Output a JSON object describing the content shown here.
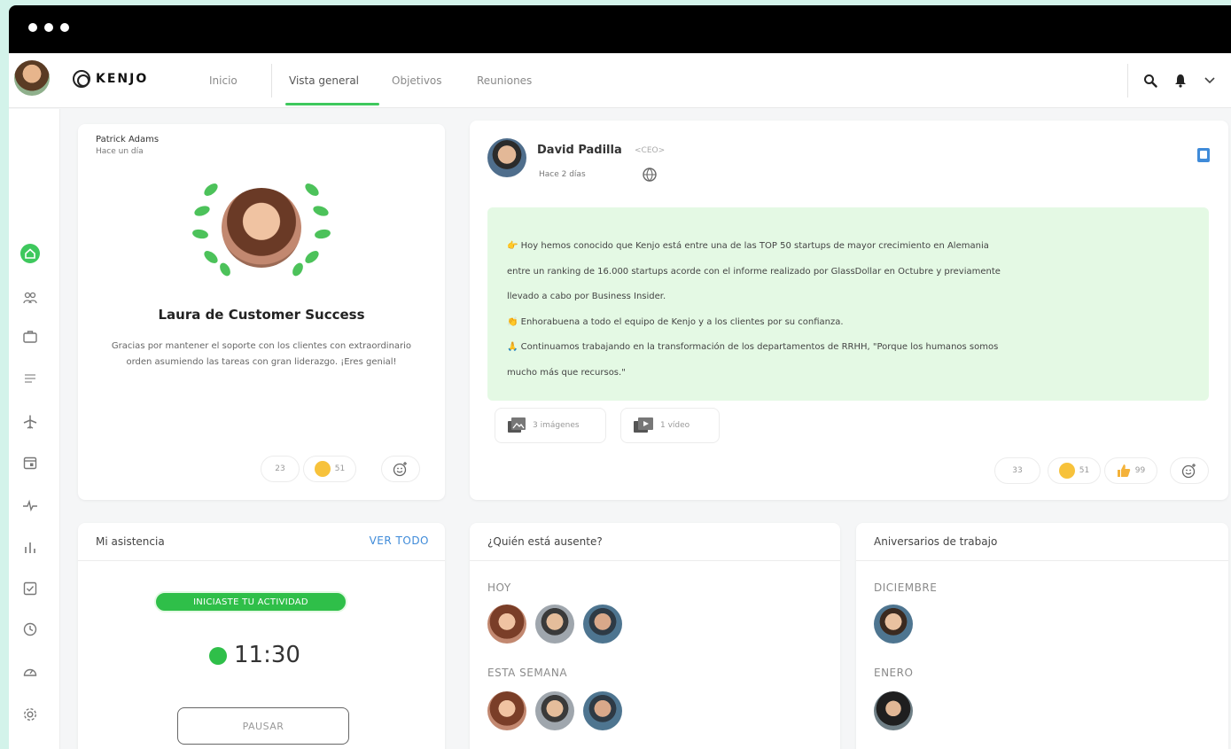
{
  "header": {
    "brand": "KENJO",
    "nav": [
      "Inicio",
      "Vista general",
      "Objetivos",
      "Reuniones"
    ],
    "active_tab": "Vista general"
  },
  "icons": {
    "top": [
      "search-icon",
      "bell-icon",
      "chevron-down-icon"
    ],
    "sidebar": [
      "home-icon",
      "people-icon",
      "briefcase-icon",
      "document-icon",
      "plane-icon",
      "calendar-icon",
      "pulse-icon",
      "chart-icon",
      "checkbox-icon",
      "clock-icon",
      "gauge-icon",
      "gear-icon"
    ]
  },
  "kudos_card": {
    "author": "Patrick Adams",
    "time": "Hace un día",
    "title": "Laura de Customer Success",
    "message": "Gracias por mantener el soporte con los clientes con extraordinario orden asumiendo las tareas con gran liderazgo. ¡Eres genial!",
    "reactions": {
      "count": "23",
      "smile_count": "51"
    }
  },
  "post_card": {
    "author": "David Padilla",
    "role": "<CEO>",
    "time": "Hace 2 días",
    "lines": [
      "👉 Hoy hemos conocido que Kenjo está entre una de las TOP 50 startups de mayor crecimiento en Alemania",
      "entre un ranking de 16.000 startups acorde con el informe realizado por GlassDollar en Octubre y previamente",
      "llevado a cabo por Business Insider.",
      "👏 Enhorabuena a todo el equipo de Kenjo y a los clientes por su confianza.",
      "🙏 Continuamos trabajando en la transformación de los departamentos de RRHH, \"Porque los humanos somos",
      "mucho más que recursos.\""
    ],
    "attachments": {
      "images": "3 imágenes",
      "videos": "1 vídeo"
    },
    "reactions": {
      "count": "33",
      "smile_count": "51",
      "like_count": "99"
    }
  },
  "attendance": {
    "title": "Mi asistencia",
    "view_all": "VER TODO",
    "status": "INICIASTE TU ACTIVIDAD",
    "time": "11:30",
    "pause_label": "PAUSAR"
  },
  "absences": {
    "title": "¿Quién está ausente?",
    "today": "HOY",
    "week": "ESTA SEMANA"
  },
  "anniversaries": {
    "title": "Aniversarios de trabajo",
    "month1": "DICIEMBRE",
    "month2": "ENERO"
  },
  "colors": {
    "accent": "#3ec85d",
    "post_bg": "#e4f9e4",
    "link_blue": "#3f8bd9"
  }
}
